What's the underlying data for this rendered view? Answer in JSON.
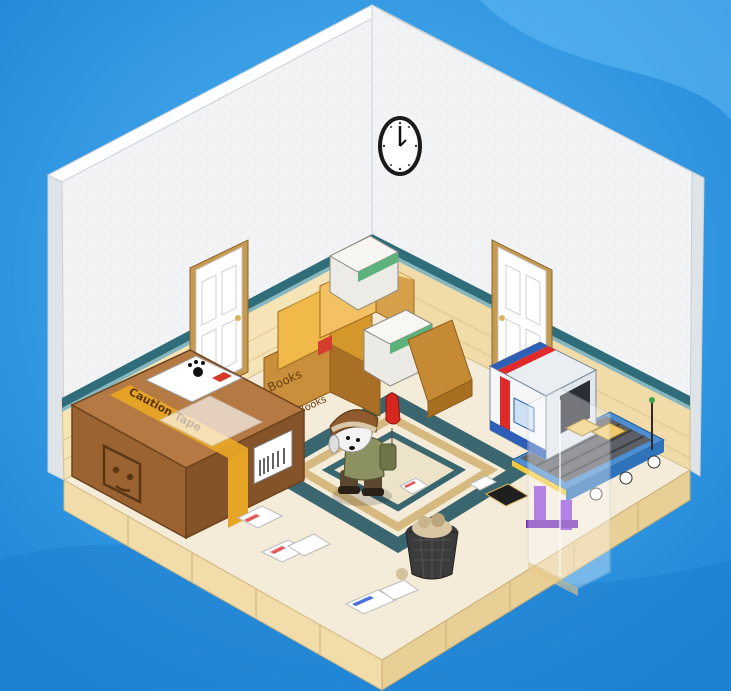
{
  "scene": {
    "type": "isometric-room",
    "background_color": "#2f9ee8",
    "wall_color": "#eef1f3",
    "floor_tile_color": "#f3ead2",
    "wainscot_color": "#f6e3b4"
  },
  "labels": {
    "box_label_1": "Books",
    "box_label_2": "Books",
    "tape_text": "Caution Tape",
    "box_tape": "Fragile"
  },
  "icons": {
    "clock": "wall-clock-icon",
    "paw": "paw-print-icon",
    "barcode": "barcode-icon"
  }
}
